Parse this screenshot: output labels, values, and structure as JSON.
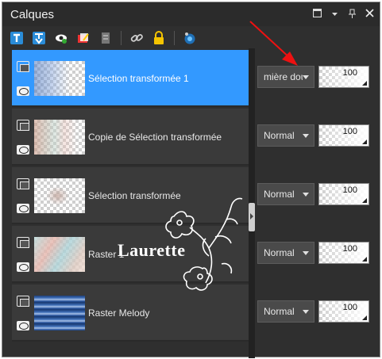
{
  "window": {
    "title": "Calques",
    "controls": [
      "maximize-icon",
      "dropdown-icon",
      "pin-icon",
      "close-icon"
    ]
  },
  "toolbar": {
    "icons": [
      "new-raster-layer-icon",
      "new-vector-layer-icon",
      "eye-visibility-icon",
      "mask-icon",
      "group-icon",
      "link-icon",
      "lock-icon",
      "properties-icon"
    ]
  },
  "layers": [
    {
      "name": "Sélection transformée 1",
      "blend": "mière dou",
      "opacity": "100",
      "selected": true,
      "thumb": "blue-sketch"
    },
    {
      "name": "Copie de Sélection transformée",
      "blend": "Normal",
      "opacity": "100",
      "selected": false,
      "thumb": "pastel-left"
    },
    {
      "name": "Sélection transformée",
      "blend": "Normal",
      "opacity": "100",
      "selected": false,
      "thumb": "small-center"
    },
    {
      "name": "Raster 1",
      "blend": "Normal",
      "opacity": "100",
      "selected": false,
      "thumb": "pastel-full"
    },
    {
      "name": "Raster Melody",
      "blend": "Normal",
      "opacity": "100",
      "selected": false,
      "thumb": "blue-stripes"
    }
  ],
  "watermark": "Laurette",
  "colors": {
    "panel_bg": "#2f2f2f",
    "selected": "#3399ff",
    "annotation_arrow": "#ee1111"
  }
}
